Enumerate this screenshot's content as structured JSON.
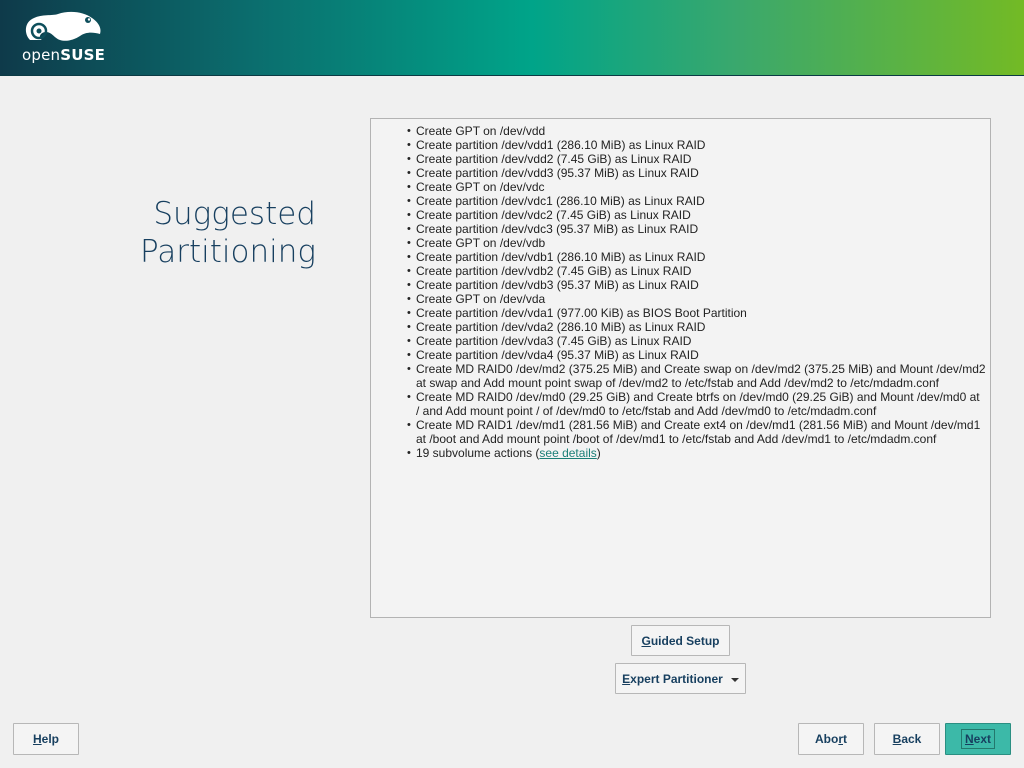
{
  "brand": {
    "logo_thin": "open",
    "logo_bold": "SUSE"
  },
  "title_lines": [
    "Suggested",
    "Partitioning"
  ],
  "actions": [
    "Create GPT on /dev/vdd",
    "Create partition /dev/vdd1 (286.10 MiB) as Linux RAID",
    "Create partition /dev/vdd2 (7.45 GiB) as Linux RAID",
    "Create partition /dev/vdd3 (95.37 MiB) as Linux RAID",
    "Create GPT on /dev/vdc",
    "Create partition /dev/vdc1 (286.10 MiB) as Linux RAID",
    "Create partition /dev/vdc2 (7.45 GiB) as Linux RAID",
    "Create partition /dev/vdc3 (95.37 MiB) as Linux RAID",
    "Create GPT on /dev/vdb",
    "Create partition /dev/vdb1 (286.10 MiB) as Linux RAID",
    "Create partition /dev/vdb2 (7.45 GiB) as Linux RAID",
    "Create partition /dev/vdb3 (95.37 MiB) as Linux RAID",
    "Create GPT on /dev/vda",
    "Create partition /dev/vda1 (977.00 KiB) as BIOS Boot Partition",
    "Create partition /dev/vda2 (286.10 MiB) as Linux RAID",
    "Create partition /dev/vda3 (7.45 GiB) as Linux RAID",
    "Create partition /dev/vda4 (95.37 MiB) as Linux RAID",
    "Create MD RAID0 /dev/md2 (375.25 MiB) and Create swap on /dev/md2 (375.25 MiB) and Mount /dev/md2 at swap and Add mount point swap of /dev/md2 to /etc/fstab and Add /dev/md2 to /etc/mdadm.conf",
    "Create MD RAID0 /dev/md0 (29.25 GiB) and Create btrfs on /dev/md0 (29.25 GiB) and Mount /dev/md0 at / and Add mount point / of /dev/md0 to /etc/fstab and Add /dev/md0 to /etc/mdadm.conf",
    "Create MD RAID1 /dev/md1 (281.56 MiB) and Create ext4 on /dev/md1 (281.56 MiB) and Mount /dev/md1 at /boot and Add mount point /boot of /dev/md1 to /etc/fstab and Add /dev/md1 to /etc/mdadm.conf"
  ],
  "subvolume": {
    "prefix": "19 subvolume actions (",
    "link": "see details",
    "suffix": ")"
  },
  "buttons": {
    "guided_setup": {
      "hotkey": "G",
      "rest": "uided Setup"
    },
    "expert_partitioner": {
      "hotkey": "E",
      "rest": "xpert Partitioner"
    },
    "help": {
      "hotkey": "H",
      "rest": "elp"
    },
    "abort": {
      "pre": "Abo",
      "hotkey": "r",
      "rest": "t"
    },
    "back": {
      "hotkey": "B",
      "rest": "ack"
    },
    "next": {
      "hotkey": "N",
      "rest": "ext"
    }
  },
  "colors": {
    "accent": "#3cb9a8",
    "title": "#173f5f",
    "link": "#1b7f77"
  }
}
